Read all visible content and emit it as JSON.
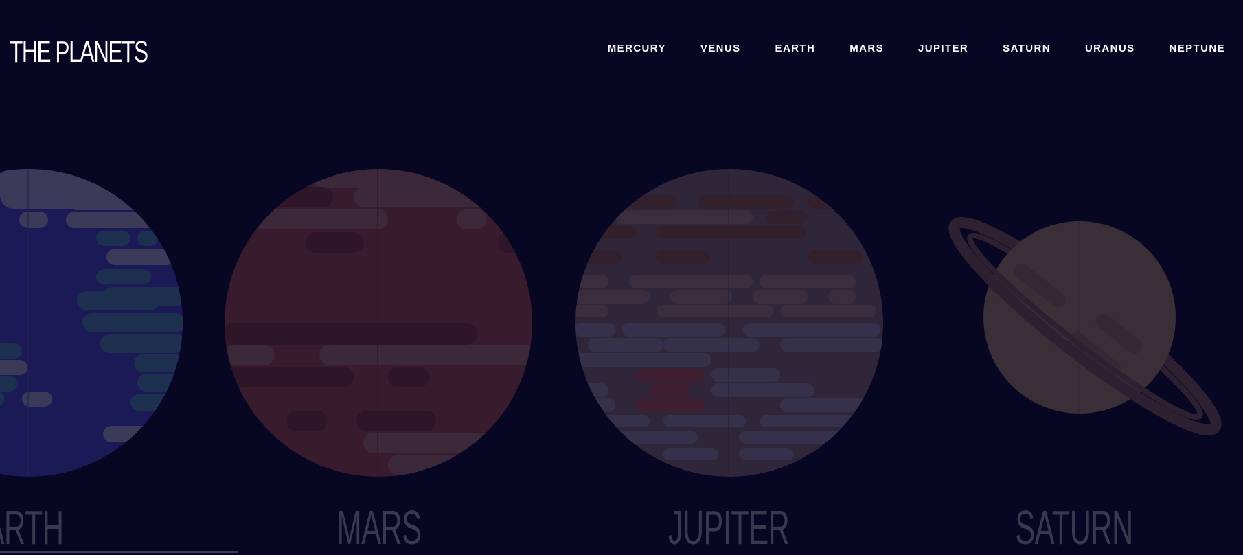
{
  "header": {
    "logo": "THE PLANETS",
    "nav": [
      {
        "label": "MERCURY"
      },
      {
        "label": "VENUS"
      },
      {
        "label": "EARTH"
      },
      {
        "label": "MARS"
      },
      {
        "label": "JUPITER"
      },
      {
        "label": "SATURN"
      },
      {
        "label": "URANUS"
      },
      {
        "label": "NEPTUNE"
      }
    ]
  },
  "carousel": {
    "planets": [
      {
        "name": "ARTH",
        "color": "#1d1b5e"
      },
      {
        "name": "MARS",
        "color": "#3a1b2c"
      },
      {
        "name": "JUPITER",
        "color": "#312733"
      },
      {
        "name": "SATURN",
        "color": "#3a2d36"
      }
    ]
  },
  "colors": {
    "background": "#070724",
    "text": "#ffffff",
    "muted": "#38384f"
  }
}
